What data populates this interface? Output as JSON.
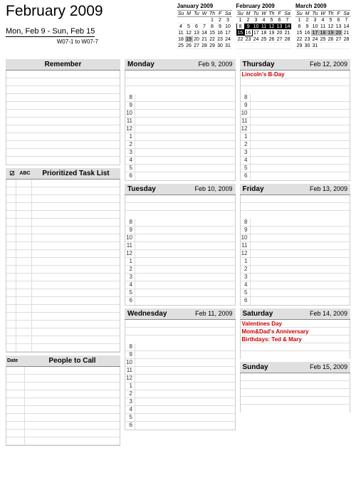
{
  "header": {
    "title": "February 2009",
    "range": "Mon, Feb 9  -  Sun, Feb 15",
    "week_note": "W07-1 to W07-7"
  },
  "mini_calendars": [
    {
      "title": "January 2009",
      "dow": [
        "Su",
        "M",
        "Tu",
        "W",
        "Th",
        "F",
        "Sa"
      ],
      "rows": [
        [
          "",
          "",
          "",
          "",
          "1",
          "2",
          "3"
        ],
        [
          "4",
          "5",
          "6",
          "7",
          "8",
          "9",
          "10"
        ],
        [
          "11",
          "12",
          "13",
          "14",
          "15",
          "16",
          "17"
        ],
        [
          "18",
          "19",
          "20",
          "21",
          "22",
          "23",
          "24"
        ],
        [
          "25",
          "26",
          "27",
          "28",
          "29",
          "30",
          "31"
        ]
      ],
      "highlight": {
        "gray": [
          "19"
        ]
      }
    },
    {
      "title": "February 2009",
      "dow": [
        "Su",
        "M",
        "Tu",
        "W",
        "Th",
        "F",
        "Sa"
      ],
      "rows": [
        [
          "1",
          "2",
          "3",
          "4",
          "5",
          "6",
          "7"
        ],
        [
          "8",
          "9",
          "10",
          "11",
          "12",
          "13",
          "14"
        ],
        [
          "15",
          "16",
          "17",
          "18",
          "19",
          "20",
          "21"
        ],
        [
          "22",
          "23",
          "24",
          "25",
          "26",
          "27",
          "28"
        ],
        [
          "",
          "",
          "",
          "",
          "",
          "",
          ""
        ]
      ],
      "highlight": {
        "dark": [
          "9",
          "10",
          "11",
          "12",
          "13",
          "14",
          "15"
        ],
        "box": [
          "8",
          "16"
        ]
      }
    },
    {
      "title": "March 2009",
      "dow": [
        "Su",
        "M",
        "Tu",
        "W",
        "Th",
        "F",
        "Sa"
      ],
      "rows": [
        [
          "1",
          "2",
          "3",
          "4",
          "5",
          "6",
          "7"
        ],
        [
          "8",
          "9",
          "10",
          "11",
          "12",
          "13",
          "14"
        ],
        [
          "15",
          "16",
          "17",
          "18",
          "19",
          "20",
          "21"
        ],
        [
          "22",
          "23",
          "24",
          "25",
          "26",
          "27",
          "28"
        ],
        [
          "29",
          "30",
          "31",
          "",
          "",
          "",
          ""
        ]
      ],
      "highlight": {
        "gray": [
          "17",
          "18",
          "19",
          "20"
        ]
      }
    }
  ],
  "left": {
    "remember_label": "Remember",
    "remember_rows": 12,
    "ptl_label": "Prioritized Task List",
    "ptl_col1": "☑",
    "ptl_col2": "ABC",
    "ptl_rows": 22,
    "ppl_label": "People to Call",
    "ppl_col1": "Date",
    "ppl_rows": 10
  },
  "hours": [
    "8",
    "9",
    "10",
    "11",
    "12",
    "1",
    "2",
    "3",
    "4",
    "5",
    "6"
  ],
  "days_col1": [
    {
      "label": "Monday",
      "date": "Feb 9, 2009",
      "events": [],
      "event_rows": 3
    },
    {
      "label": "Tuesday",
      "date": "Feb 10, 2009",
      "events": [],
      "event_rows": 3
    },
    {
      "label": "Wednesday",
      "date": "Feb 11, 2009",
      "events": [],
      "event_rows": 3
    }
  ],
  "days_col2": [
    {
      "label": "Thursday",
      "date": "Feb 12, 2009",
      "events": [
        "Lincoln's B-Day"
      ],
      "event_rows": 3
    },
    {
      "label": "Friday",
      "date": "Feb 13, 2009",
      "events": [],
      "event_rows": 3
    },
    {
      "label": "Saturday",
      "date": "Feb 14, 2009",
      "events": [
        "Valentines Day",
        "Mom&Dad's Anniversary",
        "Birthdays: Ted & Mary"
      ],
      "event_rows": 5,
      "no_hours": true
    },
    {
      "label": "Sunday",
      "date": "Feb 15, 2009",
      "events": [],
      "event_rows": 5,
      "no_hours": true
    }
  ]
}
